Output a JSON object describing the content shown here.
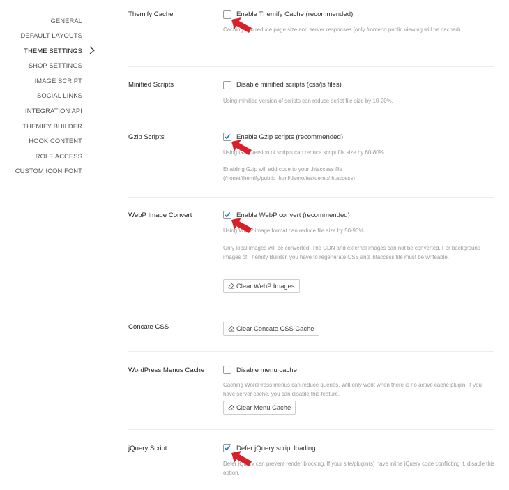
{
  "sidebar": {
    "items": [
      {
        "label": "GENERAL",
        "active": false
      },
      {
        "label": "DEFAULT LAYOUTS",
        "active": false
      },
      {
        "label": "THEME SETTINGS",
        "active": true
      },
      {
        "label": "SHOP SETTINGS",
        "active": false
      },
      {
        "label": "IMAGE SCRIPT",
        "active": false
      },
      {
        "label": "SOCIAL LINKS",
        "active": false
      },
      {
        "label": "INTEGRATION API",
        "active": false
      },
      {
        "label": "THEMIFY BUILDER",
        "active": false
      },
      {
        "label": "HOOK CONTENT",
        "active": false
      },
      {
        "label": "ROLE ACCESS",
        "active": false
      },
      {
        "label": "CUSTOM ICON FONT",
        "active": false
      }
    ],
    "active_indicator_icon": "chevron-right-icon"
  },
  "settings": {
    "themify_cache": {
      "label": "Themify Cache",
      "checkbox_label": "Enable Themify Cache (recommended)",
      "checked": false,
      "help": "Caching can reduce page size and server responses (only frontend public viewing will be cached)."
    },
    "minified_scripts": {
      "label": "Minified Scripts",
      "checkbox_label": "Disable minified scripts (css/js files)",
      "checked": false,
      "help": "Using minified version of scripts can reduce script file size by 10-20%."
    },
    "gzip_scripts": {
      "label": "Gzip Scripts",
      "checkbox_label": "Enable Gzip scripts (recommended)",
      "checked": true,
      "help": "Using Gzip version of scripts can reduce script file size by 60-80%.",
      "help2_line1": "Enabling Gzip will add code to your .htaccess file",
      "help2_line2": "(/home/themify/public_html/demo/testdemo/.htaccess)"
    },
    "webp_convert": {
      "label": "WebP Image Convert",
      "checkbox_label": "Enable WebP convert (recommended)",
      "checked": true,
      "help": "Using WebP image format can reduce file size by 50-90%.",
      "help2": "Only local images will be converted. The CDN and external images can not be converted. For background images of Themify Builder, you have to regenerate CSS and .htaccess file must be writeable.",
      "button": "Clear WebP Images"
    },
    "concate_css": {
      "label": "Concate CSS",
      "button": "Clear Concate CSS Cache"
    },
    "menus_cache": {
      "label": "WordPress Menus Cache",
      "checkbox_label": "Disable menu cache",
      "checked": false,
      "help": "Caching WordPress menus can reduce queries. Will only work when there is no active cache plugin. If you have server cache, you can disable this feature.",
      "button": "Clear Menu Cache"
    },
    "jquery_script": {
      "label": "jQuery Script",
      "checkbox_label": "Defer jQuery script loading",
      "checked": true,
      "help": "Defer jQuery can prevent render blocking. If your site/plugin(s) have inline jQuery code conflicting it, disable this option."
    }
  },
  "colors": {
    "check_mark": "#1e73be",
    "annotation_arrow": "#d9202a",
    "help_text": "#9a9a9a",
    "divider": "#ececec"
  }
}
